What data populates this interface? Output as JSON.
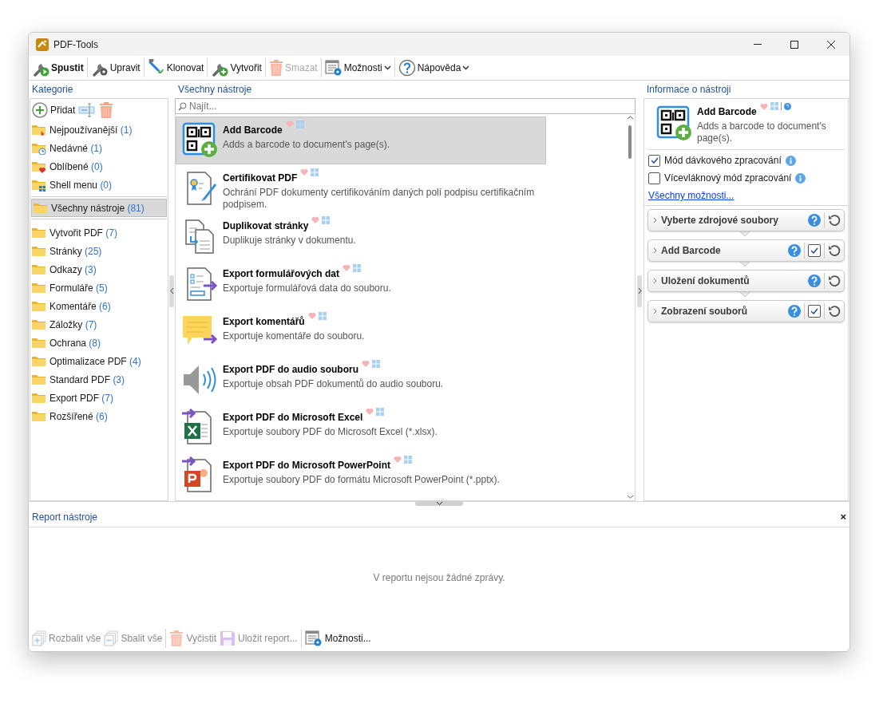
{
  "window": {
    "title": "PDF-Tools"
  },
  "toolbar": [
    {
      "label": "Spustit",
      "kind": "run",
      "bold": true,
      "disabled": false,
      "dropdown": false
    },
    {
      "label": "Upravit",
      "kind": "edit",
      "bold": false,
      "disabled": false,
      "dropdown": false
    },
    {
      "label": "Klonovat",
      "kind": "clone",
      "bold": false,
      "disabled": false,
      "dropdown": false
    },
    {
      "label": "Vytvořit",
      "kind": "create",
      "bold": false,
      "disabled": false,
      "dropdown": false
    },
    {
      "label": "Smazat",
      "kind": "trash",
      "bold": false,
      "disabled": true,
      "dropdown": false
    },
    {
      "label": "Možnosti",
      "kind": "options",
      "bold": false,
      "disabled": false,
      "dropdown": true
    },
    {
      "label": "Nápověda",
      "kind": "help",
      "bold": false,
      "disabled": false,
      "dropdown": true
    }
  ],
  "categories": {
    "header": "Kategorie",
    "add_label": "Přidat",
    "special": [
      {
        "label": "Nejpoužívanější",
        "count": "(1)",
        "kind": "fire"
      },
      {
        "label": "Nedávné",
        "count": "(1)",
        "kind": "clock"
      },
      {
        "label": "Oblíbené",
        "count": "(0)",
        "kind": "heart"
      },
      {
        "label": "Shell menu",
        "count": "(0)",
        "kind": "windows"
      }
    ],
    "all": {
      "label": "Všechny nástroje",
      "count": "(81)",
      "selected": true
    },
    "folders": [
      {
        "label": "Vytvořit PDF",
        "count": "(7)"
      },
      {
        "label": "Stránky",
        "count": "(25)"
      },
      {
        "label": "Odkazy",
        "count": "(3)"
      },
      {
        "label": "Formuláře",
        "count": "(5)"
      },
      {
        "label": "Komentáře",
        "count": "(6)"
      },
      {
        "label": "Záložky",
        "count": "(7)"
      },
      {
        "label": "Ochrana",
        "count": "(8)"
      },
      {
        "label": "Optimalizace PDF",
        "count": "(4)"
      },
      {
        "label": "Standard PDF",
        "count": "(3)"
      },
      {
        "label": "Export PDF",
        "count": "(7)"
      },
      {
        "label": "Rozšířené",
        "count": "(6)"
      }
    ]
  },
  "tools": {
    "header": "Všechny nástroje",
    "search": {
      "placeholder": "Najít..."
    },
    "items": [
      {
        "title": "Add Barcode",
        "description": "Adds a barcode to document's page(s).",
        "kind": "barcode",
        "selected": true
      },
      {
        "title": "Certifikovat PDF",
        "description": "Ochrání PDF dokumenty certifikováním daných polí podpisu certifikačním podpisem.",
        "kind": "certificate",
        "selected": false
      },
      {
        "title": "Duplikovat stránky",
        "description": "Duplikuje stránky v dokumentu.",
        "kind": "duplicate",
        "selected": false
      },
      {
        "title": "Export formulářových dat",
        "description": "Exportuje formulářová data do souboru.",
        "kind": "form",
        "selected": false
      },
      {
        "title": "Export komentářů",
        "description": "Exportuje komentáře do souboru.",
        "kind": "comment",
        "selected": false
      },
      {
        "title": "Export PDF do audio souboru",
        "description": "Exportuje obsah PDF dokumentů do audio souboru.",
        "kind": "audio",
        "selected": false
      },
      {
        "title": "Export PDF do Microsoft Excel",
        "description": "Exportuje soubory PDF do Microsoft Excel (*.xlsx).",
        "kind": "excel",
        "selected": false
      },
      {
        "title": "Export PDF do Microsoft PowerPoint",
        "description": "Exportuje soubory PDF do formátu Microsoft PowerPoint (*.pptx).",
        "kind": "powerpoint",
        "selected": false
      }
    ]
  },
  "info": {
    "header": "Informace o nástroji",
    "title": "Add Barcode",
    "description": "Adds a barcode to document's page(s).",
    "options": [
      {
        "label": "Mód dávkového zpracování",
        "checked": true
      },
      {
        "label": "Vícevláknový mód zpracování",
        "checked": false
      }
    ],
    "link": "Všechny možnosti...",
    "steps": [
      {
        "label": "Vyberte zdrojové soubory",
        "kind": "plain"
      },
      {
        "label": "Add Barcode",
        "kind": "checkable",
        "checked": true
      },
      {
        "label": "Uložení dokumentů",
        "kind": "plain"
      },
      {
        "label": "Zobrazení souborů",
        "kind": "checkable",
        "checked": true
      }
    ]
  },
  "report": {
    "header": "Report nástroje",
    "close": "×",
    "message": "V reportu nejsou žádné zprávy.",
    "toolbar": [
      {
        "label": "Rozbalit vše",
        "kind": "expand",
        "disabled": true
      },
      {
        "label": "Sbalit vše",
        "kind": "collapse",
        "disabled": true
      },
      {
        "label": "Vyčistit",
        "kind": "trash",
        "disabled": true
      },
      {
        "label": "Uložit report...",
        "kind": "save",
        "disabled": true
      },
      {
        "label": "Možnosti...",
        "kind": "options",
        "disabled": false
      }
    ]
  }
}
